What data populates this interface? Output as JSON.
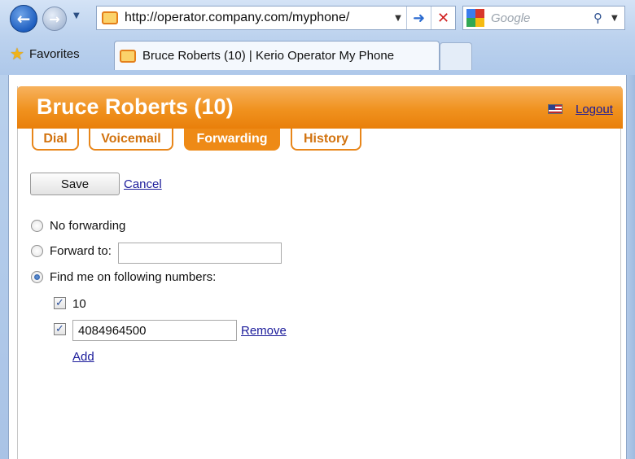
{
  "browser": {
    "address_url": "http://operator.company.com/myphone/",
    "search_placeholder": "Google",
    "favorites_label": "Favorites",
    "tab_title": "Bruce Roberts (10) | Kerio Operator My Phone",
    "icons": {
      "back": "back-arrow-icon",
      "forward": "forward-arrow-icon",
      "go": "go-arrow-icon",
      "stop": "stop-x-icon",
      "search": "magnifier-icon",
      "favorites": "star-icon"
    }
  },
  "header": {
    "title": "Bruce Roberts (10)",
    "logout_label": "Logout",
    "accent_color": "#ef8a16"
  },
  "tabs": [
    {
      "label": "Dial",
      "active": false
    },
    {
      "label": "Voicemail",
      "active": false
    },
    {
      "label": "Forwarding",
      "active": true
    },
    {
      "label": "History",
      "active": false
    }
  ],
  "actions": {
    "save_label": "Save",
    "cancel_label": "Cancel"
  },
  "forwarding": {
    "selected_option": "Find me on following numbers:",
    "options": {
      "no_forwarding": "No forwarding",
      "forward_to": "Forward to:",
      "find_me": "Find me on following numbers:"
    },
    "forward_to_value": "",
    "numbers": [
      {
        "value": "10",
        "checked": true,
        "editable": false
      },
      {
        "value": "4084964500",
        "checked": true,
        "editable": true,
        "remove_label": "Remove"
      }
    ],
    "add_label": "Add"
  }
}
